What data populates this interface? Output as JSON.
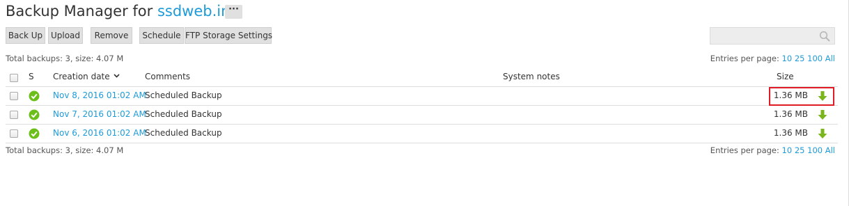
{
  "heading": {
    "prefix": "Backup Manager for ",
    "site": "ssdweb.in",
    "more_label": "···"
  },
  "toolbar": {
    "buttons": [
      "Back Up",
      "Upload",
      "Remove",
      "Schedule",
      "FTP Storage Settings"
    ]
  },
  "search": {
    "placeholder": "",
    "icon": "search-icon"
  },
  "summary_top": "Total backups: 3, size: 4.07 M",
  "summary_bottom": "Total backups: 3, size: 4.07 M",
  "entries_per_page": {
    "label": "Entries per page:",
    "options": [
      "10",
      "25",
      "100",
      "All"
    ]
  },
  "table": {
    "columns": {
      "status": "S",
      "creation_date": "Creation date",
      "comments": "Comments",
      "system_notes": "System notes",
      "size": "Size"
    },
    "sort_indicator": "chevron-down-icon",
    "rows": [
      {
        "date": "Nov 8, 2016 01:02 AM",
        "comment": "Scheduled Backup",
        "system_notes": "",
        "size": "1.36 MB"
      },
      {
        "date": "Nov 7, 2016 01:02 AM",
        "comment": "Scheduled Backup",
        "system_notes": "",
        "size": "1.36 MB"
      },
      {
        "date": "Nov 6, 2016 01:02 AM",
        "comment": "Scheduled Backup",
        "system_notes": "",
        "size": "1.36 MB"
      }
    ]
  },
  "colors": {
    "link": "#1d9bd8",
    "success": "#6cbf1a",
    "download": "#7ab51d",
    "highlight": "#e01b24"
  }
}
